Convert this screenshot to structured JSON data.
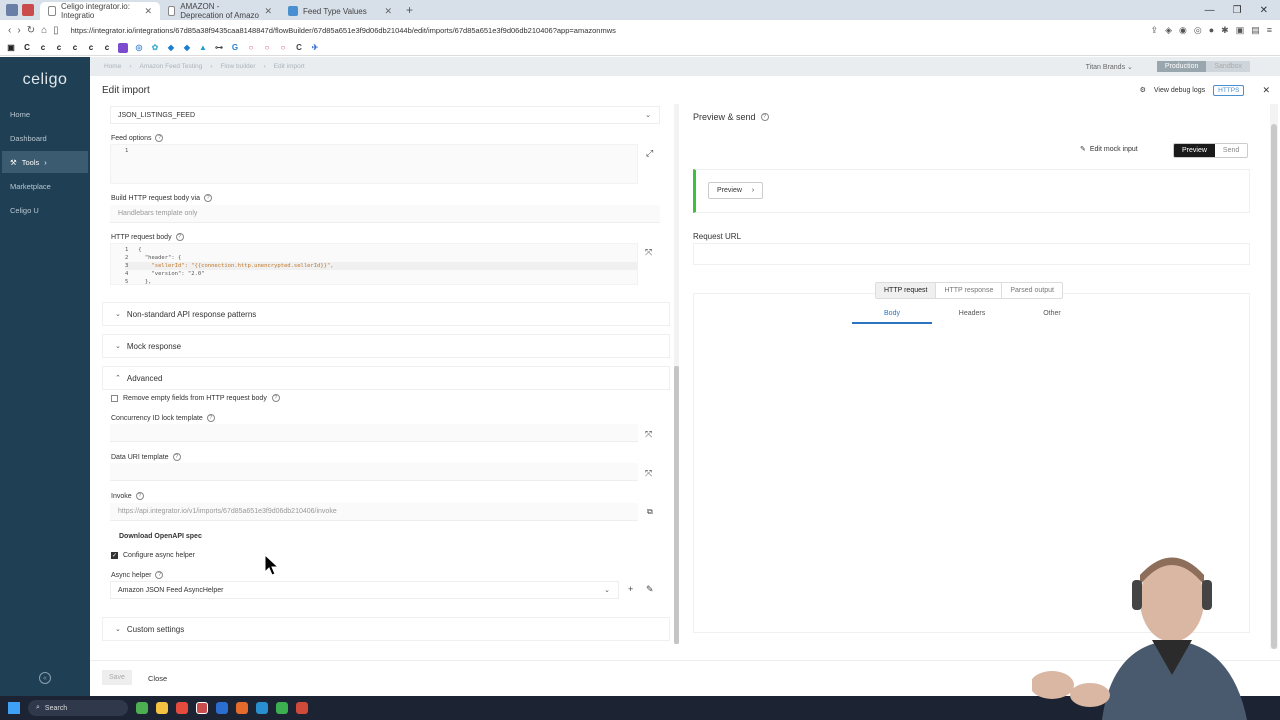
{
  "browser": {
    "tabs": [
      {
        "title": "Celigo integrator.io: Integratio",
        "active": true
      },
      {
        "title": "AMAZON - Deprecation of Amazo",
        "active": false
      },
      {
        "title": "Feed Type Values",
        "active": false
      }
    ],
    "url": "https://integrator.io/integrations/67d85a38f9435caa8148847d/flowBuilder/67d85a651e3f9d06db21044b/edit/imports/67d85a651e3f9d06db210406?app=amazonmws"
  },
  "app": {
    "logo": "celigo",
    "nav": [
      {
        "label": "Home"
      },
      {
        "label": "Dashboard"
      },
      {
        "label": "Tools"
      },
      {
        "label": "Marketplace"
      },
      {
        "label": "Celigo U"
      }
    ],
    "breadcrumb": [
      "Home",
      "Amazon Feed Testing",
      "Flow builder",
      "Edit import"
    ],
    "account": "Titan Brands",
    "env": {
      "production": "Production",
      "sandbox": "Sandbox"
    }
  },
  "header": {
    "title": "Edit import",
    "debug_logs": "View debug logs",
    "https_badge": "HTTPS"
  },
  "form": {
    "feed_type_value": "JSON_LISTINGS_FEED",
    "feed_options_label": "Feed options",
    "feed_options_lines": [
      "1"
    ],
    "build_body_label": "Build HTTP request body via",
    "build_body_value": "Handlebars template only",
    "http_body_label": "HTTP request body",
    "http_body_lines": [
      {
        "n": "1",
        "code": "{"
      },
      {
        "n": "2",
        "code": "  \"header\": {"
      },
      {
        "n": "3",
        "code": "    \"sellerId\": \"{{connection.http.unencrypted.sellerId}}\","
      },
      {
        "n": "4",
        "code": "    \"version\": \"2.0\""
      },
      {
        "n": "5",
        "code": "  },"
      }
    ],
    "sections": {
      "nonstandard": "Non-standard API response patterns",
      "mock": "Mock response",
      "advanced": "Advanced",
      "custom": "Custom settings"
    },
    "remove_empty": "Remove empty fields from HTTP request body",
    "concurrency_label": "Concurrency ID lock template",
    "data_uri_label": "Data URI template",
    "invoke_label": "Invoke",
    "invoke_value": "https://api.integrator.io/v1/imports/67d85a651e3f9d06db210406/invoke",
    "openapi_button": "Download OpenAPI spec",
    "configure_async": "Configure async helper",
    "async_label": "Async helper",
    "async_value": "Amazon JSON Feed AsyncHelper"
  },
  "preview": {
    "title": "Preview & send",
    "edit_mock": "Edit mock input",
    "mode_preview": "Preview",
    "mode_send": "Send",
    "preview_button": "Preview",
    "request_url_label": "Request URL",
    "tabs": [
      "HTTP request",
      "HTTP response",
      "Parsed output"
    ],
    "subtabs": [
      "Body",
      "Headers",
      "Other"
    ]
  },
  "footer": {
    "save": "Save",
    "close": "Close"
  },
  "taskbar": {
    "search": "Search"
  }
}
